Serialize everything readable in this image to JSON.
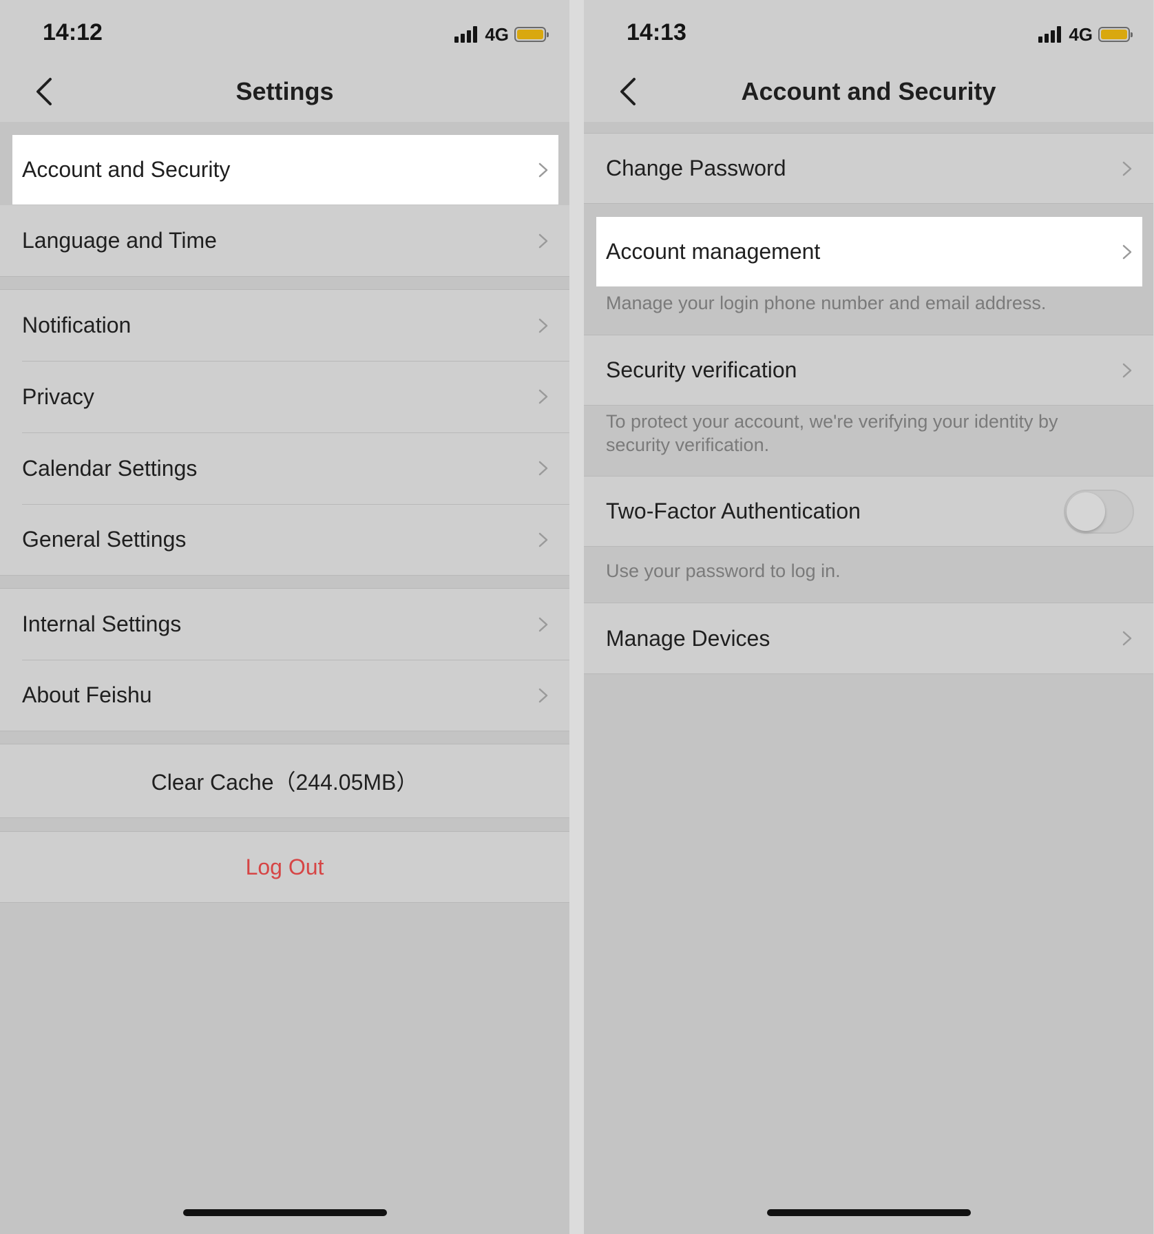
{
  "left_screen": {
    "status": {
      "time": "14:12",
      "network": "4G"
    },
    "title": "Settings",
    "items": {
      "account_security": "Account and Security",
      "language_time": "Language and Time",
      "notification": "Notification",
      "privacy": "Privacy",
      "calendar": "Calendar Settings",
      "general": "General Settings",
      "internal": "Internal Settings",
      "about": "About Feishu",
      "clear_cache": "Clear Cache（244.05MB）",
      "logout": "Log Out"
    }
  },
  "right_screen": {
    "status": {
      "time": "14:13",
      "network": "4G"
    },
    "title": "Account and Security",
    "items": {
      "change_password": "Change Password",
      "account_management": "Account management",
      "account_management_caption": "Manage your login phone number and email address.",
      "security_verification": "Security verification",
      "security_verification_caption": "To protect your account, we're verifying your identity by security verification.",
      "two_factor": "Two-Factor Authentication",
      "two_factor_enabled": false,
      "two_factor_caption": "Use your password to log in.",
      "manage_devices": "Manage Devices"
    }
  },
  "colors": {
    "highlight": "#ffffff",
    "battery": "#d9a80f",
    "logout": "#d64545",
    "overlay_background": "#c4c4c4"
  },
  "icons": [
    "back-arrow-icon",
    "chevron-right-icon",
    "signal-icon",
    "battery-icon"
  ]
}
